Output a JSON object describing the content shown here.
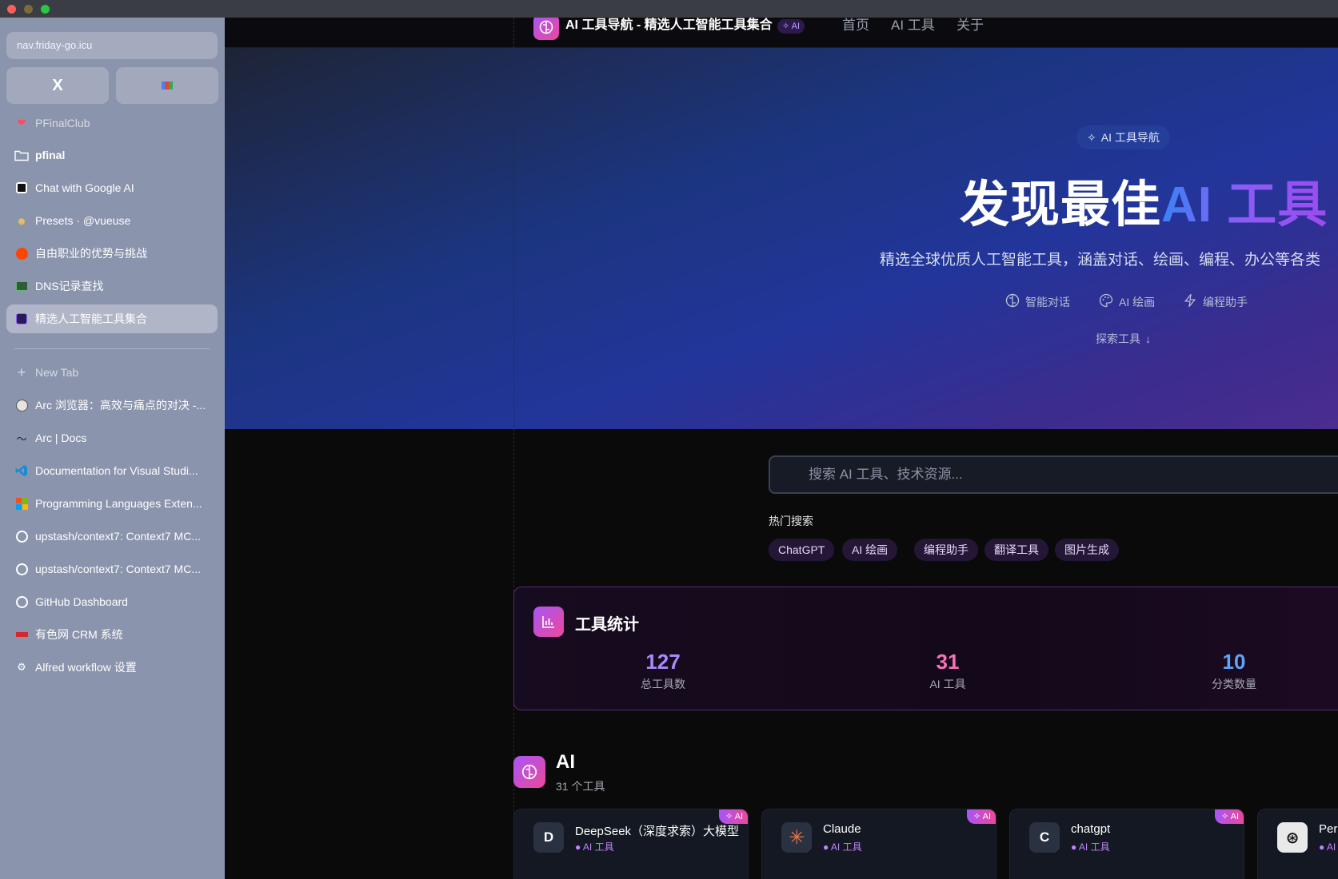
{
  "browser": {
    "url": "nav.friday-go.icu",
    "favorites": [
      {
        "icon": "x-logo-icon",
        "label": "X"
      },
      {
        "icon": "gmail-icon",
        "label": ""
      }
    ],
    "pinned": [
      {
        "icon": "heart-icon",
        "label": "PFinalClub"
      },
      {
        "icon": "folder-icon",
        "label": "pfinal"
      },
      {
        "icon": "google-ai-icon",
        "label": "Chat with Google AI"
      },
      {
        "icon": "vueuse-icon",
        "label": "Presets · @vueuse"
      },
      {
        "icon": "reddit-icon",
        "label": "自由职业的优势与挑战"
      },
      {
        "icon": "dns-icon",
        "label": "DNS记录查找"
      },
      {
        "icon": "ai-nav-icon",
        "label": "精选人工智能工具集合"
      }
    ],
    "new_tab": "New Tab",
    "tabs": [
      {
        "icon": "avatar-icon",
        "label": "Arc 浏览器：高效与痛点的对决 -..."
      },
      {
        "icon": "arc-icon",
        "label": "Arc | Docs"
      },
      {
        "icon": "vscode-icon",
        "label": "Documentation for Visual Studi..."
      },
      {
        "icon": "microsoft-icon",
        "label": "Programming Languages Exten..."
      },
      {
        "icon": "github-icon",
        "label": "upstash/context7: Context7 MC..."
      },
      {
        "icon": "github-icon",
        "label": "upstash/context7: Context7 MC..."
      },
      {
        "icon": "github-icon",
        "label": "GitHub Dashboard"
      },
      {
        "icon": "crm-icon",
        "label": "有色网 CRM 系统"
      },
      {
        "icon": "gear-icon",
        "label": "Alfred workflow 设置"
      }
    ]
  },
  "site": {
    "title": "AI 工具导航 - 精选人工智能工具集合",
    "badge": "AI",
    "nav": [
      "首页",
      "AI 工具",
      "关于"
    ]
  },
  "hero": {
    "pill": "AI 工具导航",
    "title_plain": "发现最佳",
    "title_grad": "AI 工具",
    "subtitle": "精选全球优质人工智能工具，涵盖对话、绘画、编程、办公等各类",
    "features": [
      "智能对话",
      "AI 绘画",
      "编程助手"
    ],
    "explore": "探索工具"
  },
  "search": {
    "placeholder": "搜索 AI 工具、技术资源...",
    "hot_title": "热门搜索",
    "hot": [
      "ChatGPT",
      "AI 绘画",
      "编程助手",
      "翻译工具",
      "图片生成"
    ]
  },
  "stats": {
    "title": "工具统计",
    "items": [
      {
        "value": "127",
        "label": "总工具数",
        "color": "#a78bfa"
      },
      {
        "value": "31",
        "label": "AI 工具",
        "color": "#f472b6"
      },
      {
        "value": "10",
        "label": "分类数量",
        "color": "#60a5fa"
      }
    ]
  },
  "category": {
    "title": "AI",
    "count": "31 个工具",
    "cards": [
      {
        "letter": "D",
        "name": "DeepSeek（深度求索）大模型",
        "tag": "● AI 工具",
        "corner": "✧ AI"
      },
      {
        "letter": "✳",
        "name": "Claude",
        "tag": "● AI 工具",
        "corner": "✧ AI"
      },
      {
        "letter": "C",
        "name": "chatgpt",
        "tag": "● AI 工具",
        "corner": "✧ AI"
      },
      {
        "letter": "⊛",
        "name": "Perplexity",
        "tag": "● AI 工具",
        "corner": ""
      }
    ]
  }
}
